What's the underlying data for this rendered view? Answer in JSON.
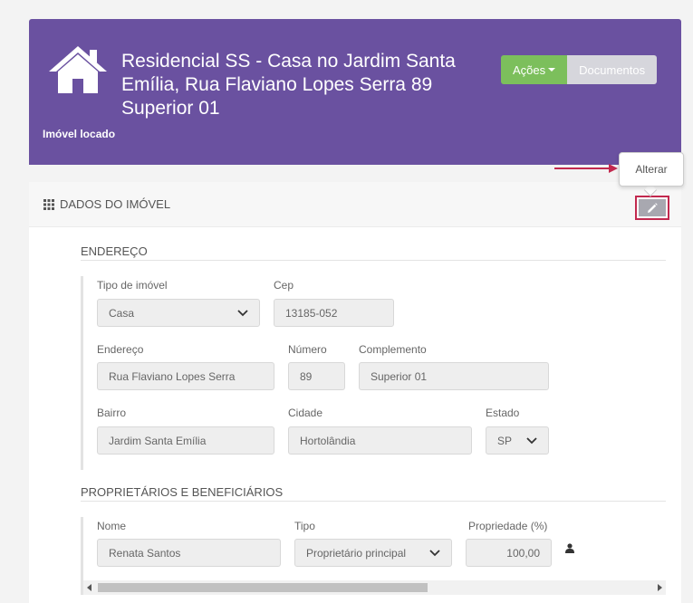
{
  "header": {
    "title": "Residencial SS - Casa no Jardim Santa Emília, Rua Flaviano Lopes Serra 89 Superior 01",
    "status": "Imóvel locado",
    "actions_label": "Ações",
    "documents_label": "Documentos",
    "bg_color": "#6a51a0",
    "home_icon": "home-icon"
  },
  "tooltip": {
    "text": "Alterar"
  },
  "panel": {
    "title": "DADOS DO IMÓVEL",
    "edit_icon": "pencil-icon"
  },
  "address": {
    "section_title": "ENDEREÇO",
    "tipo_label": "Tipo de imóvel",
    "tipo_value": "Casa",
    "cep_label": "Cep",
    "cep_value": "13185-052",
    "endereco_label": "Endereço",
    "endereco_value": "Rua Flaviano Lopes Serra",
    "numero_label": "Número",
    "numero_value": "89",
    "complemento_label": "Complemento",
    "complemento_value": "Superior 01",
    "bairro_label": "Bairro",
    "bairro_value": "Jardim Santa Emília",
    "cidade_label": "Cidade",
    "cidade_value": "Hortolândia",
    "estado_label": "Estado",
    "estado_value": "SP"
  },
  "owners": {
    "section_title": "PROPRIETÁRIOS E BENEFICIÁRIOS",
    "nome_label": "Nome",
    "nome_value": "Renata Santos",
    "tipo_label": "Tipo",
    "tipo_value": "Proprietário principal",
    "prop_label": "Propriedade (%)",
    "prop_value": "100,00"
  },
  "colors": {
    "accent_green": "#7cbf5c",
    "highlight_red": "#c2294f"
  }
}
